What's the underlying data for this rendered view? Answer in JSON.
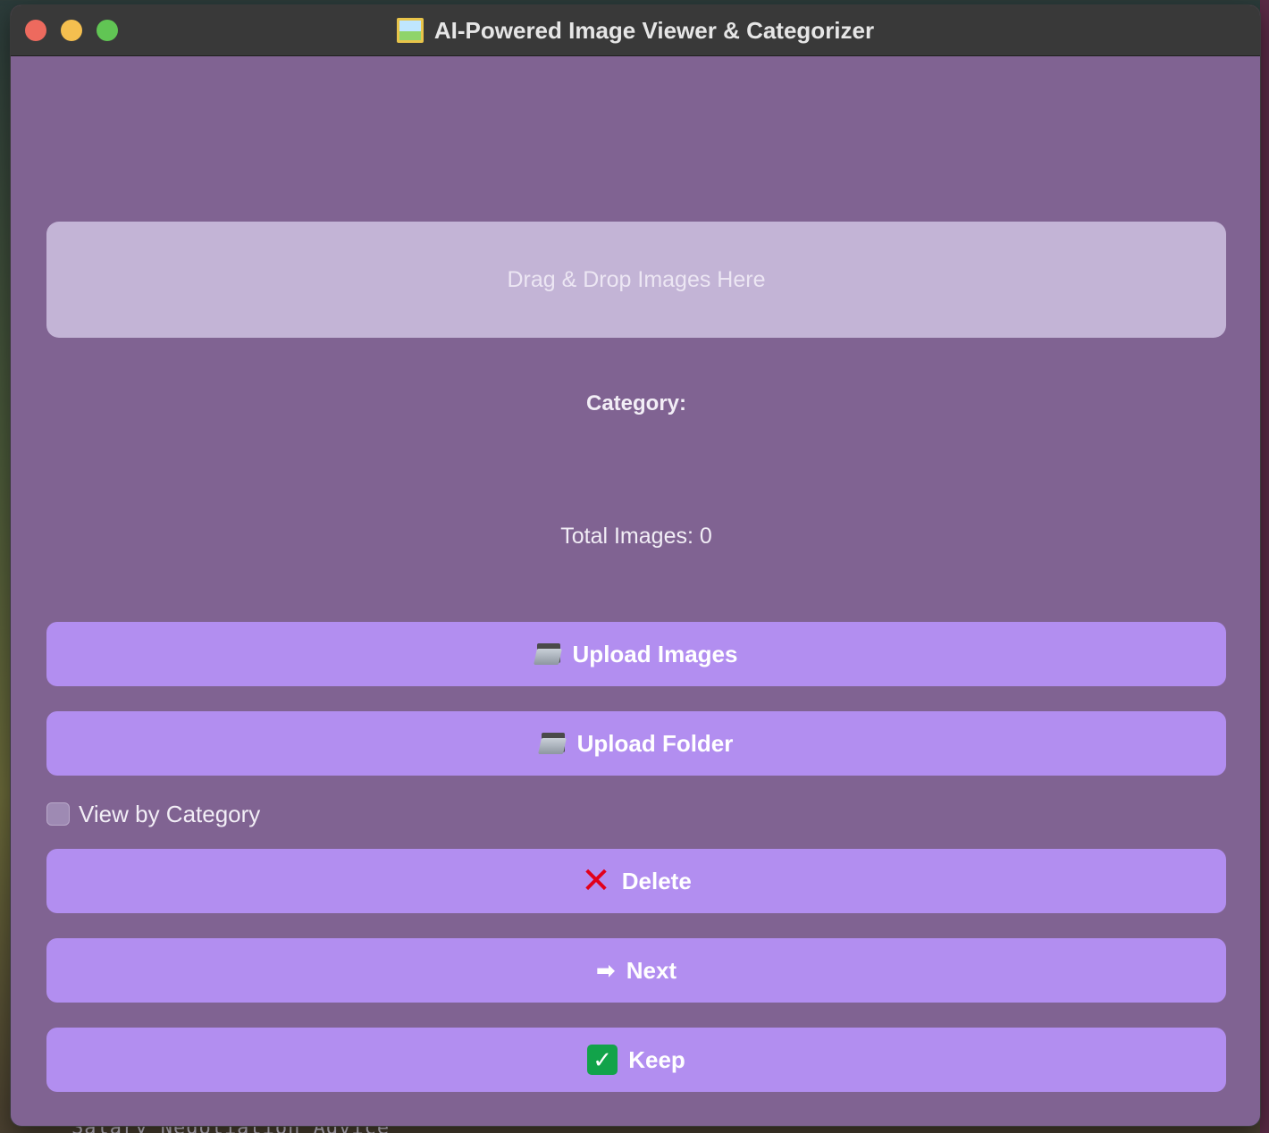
{
  "window": {
    "title": "AI-Powered Image Viewer & Categorizer",
    "title_icon": "framed-picture-icon"
  },
  "dropzone": {
    "label": "Drag & Drop Images Here"
  },
  "category": {
    "label": "Category:"
  },
  "stats": {
    "total_images": "Total Images: 0"
  },
  "buttons": {
    "upload_images": {
      "label": "Upload Images",
      "icon": "open-folder-icon"
    },
    "upload_folder": {
      "label": "Upload Folder",
      "icon": "folder-icon"
    },
    "delete": {
      "label": "Delete",
      "icon": "cross-mark-icon"
    },
    "next": {
      "label": "Next",
      "icon": "right-arrow-icon"
    },
    "keep": {
      "label": "Keep",
      "icon": "check-mark-icon"
    }
  },
  "view_by_category": {
    "label": "View by Category",
    "checked": false
  },
  "background": {
    "partial_text": "Salary Negotiation Advice"
  },
  "colors": {
    "window_bg": "#806392",
    "dropzone_bg": "#c3b4d6",
    "button_bg": "#b28ef0",
    "titlebar_bg": "#393939"
  }
}
